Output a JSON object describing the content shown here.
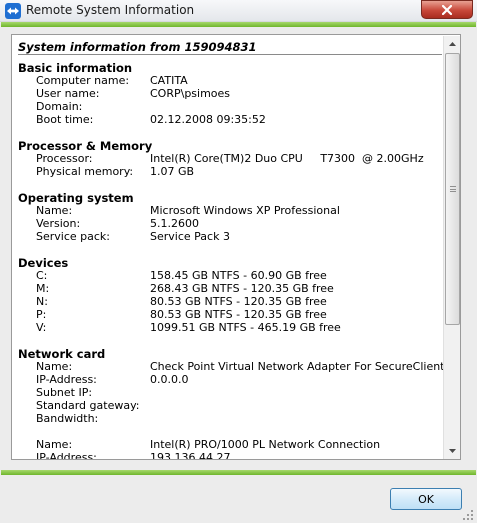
{
  "window": {
    "title": "Remote System Information",
    "icon": "teamviewer-icon",
    "close_icon": "close-icon"
  },
  "report": {
    "heading": "System information from 159094831",
    "sections": [
      {
        "title": "Basic information",
        "rows": [
          {
            "label": "Computer name:",
            "value": "CATITA"
          },
          {
            "label": "User name:",
            "value": "CORP\\psimoes"
          },
          {
            "label": "Domain:",
            "value": ""
          },
          {
            "label": "Boot time:",
            "value": "02.12.2008 09:35:52"
          }
        ]
      },
      {
        "title": "Processor & Memory",
        "rows": [
          {
            "label": "Processor:",
            "value": "Intel(R) Core(TM)2 Duo CPU     T7300  @ 2.00GHz"
          },
          {
            "label": "Physical memory:",
            "value": "1.07 GB"
          }
        ]
      },
      {
        "title": "Operating system",
        "rows": [
          {
            "label": "Name:",
            "value": "Microsoft Windows XP Professional"
          },
          {
            "label": "Version:",
            "value": "5.1.2600"
          },
          {
            "label": "Service pack:",
            "value": "Service Pack 3"
          }
        ]
      },
      {
        "title": "Devices",
        "rows": [
          {
            "label": "C:",
            "value": "158.45 GB NTFS - 60.90 GB free"
          },
          {
            "label": "M:",
            "value": "268.43 GB NTFS - 120.35 GB free"
          },
          {
            "label": "N:",
            "value": "80.53 GB NTFS - 120.35 GB free"
          },
          {
            "label": "P:",
            "value": "80.53 GB NTFS - 120.35 GB free"
          },
          {
            "label": "V:",
            "value": "1099.51 GB NTFS - 465.19 GB free"
          }
        ]
      },
      {
        "title": "Network card",
        "rows": [
          {
            "label": "Name:",
            "value": "Check Point Virtual Network Adapter For SecureClient"
          },
          {
            "label": "IP-Address:",
            "value": "0.0.0.0"
          },
          {
            "label": "Subnet IP:",
            "value": ""
          },
          {
            "label": "Standard gateway:",
            "value": ""
          },
          {
            "label": "Bandwidth:",
            "value": ""
          },
          {
            "label": "",
            "value": ""
          },
          {
            "label": "Name:",
            "value": "Intel(R) PRO/1000 PL Network Connection"
          },
          {
            "label": "IP-Address:",
            "value": "193.136.44.27"
          }
        ]
      }
    ]
  },
  "footer": {
    "ok_label": "OK"
  },
  "colors": {
    "accent_green": "#6fb52d",
    "button_border": "#3c7fb1",
    "close_red": "#c8483a"
  }
}
